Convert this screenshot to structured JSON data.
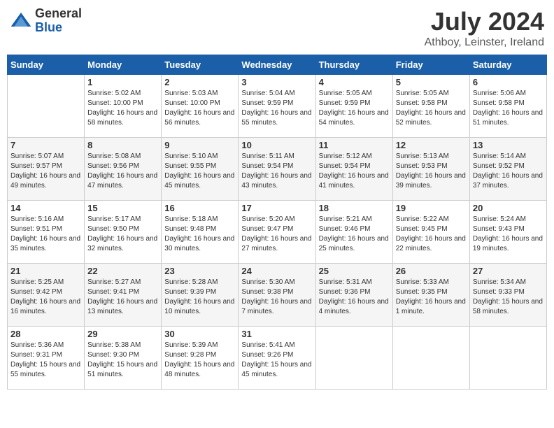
{
  "header": {
    "logo_general": "General",
    "logo_blue": "Blue",
    "month_year": "July 2024",
    "location": "Athboy, Leinster, Ireland"
  },
  "days_of_week": [
    "Sunday",
    "Monday",
    "Tuesday",
    "Wednesday",
    "Thursday",
    "Friday",
    "Saturday"
  ],
  "weeks": [
    [
      {
        "day": "",
        "sunrise": "",
        "sunset": "",
        "daylight": ""
      },
      {
        "day": "1",
        "sunrise": "Sunrise: 5:02 AM",
        "sunset": "Sunset: 10:00 PM",
        "daylight": "Daylight: 16 hours and 58 minutes."
      },
      {
        "day": "2",
        "sunrise": "Sunrise: 5:03 AM",
        "sunset": "Sunset: 10:00 PM",
        "daylight": "Daylight: 16 hours and 56 minutes."
      },
      {
        "day": "3",
        "sunrise": "Sunrise: 5:04 AM",
        "sunset": "Sunset: 9:59 PM",
        "daylight": "Daylight: 16 hours and 55 minutes."
      },
      {
        "day": "4",
        "sunrise": "Sunrise: 5:05 AM",
        "sunset": "Sunset: 9:59 PM",
        "daylight": "Daylight: 16 hours and 54 minutes."
      },
      {
        "day": "5",
        "sunrise": "Sunrise: 5:05 AM",
        "sunset": "Sunset: 9:58 PM",
        "daylight": "Daylight: 16 hours and 52 minutes."
      },
      {
        "day": "6",
        "sunrise": "Sunrise: 5:06 AM",
        "sunset": "Sunset: 9:58 PM",
        "daylight": "Daylight: 16 hours and 51 minutes."
      }
    ],
    [
      {
        "day": "7",
        "sunrise": "Sunrise: 5:07 AM",
        "sunset": "Sunset: 9:57 PM",
        "daylight": "Daylight: 16 hours and 49 minutes."
      },
      {
        "day": "8",
        "sunrise": "Sunrise: 5:08 AM",
        "sunset": "Sunset: 9:56 PM",
        "daylight": "Daylight: 16 hours and 47 minutes."
      },
      {
        "day": "9",
        "sunrise": "Sunrise: 5:10 AM",
        "sunset": "Sunset: 9:55 PM",
        "daylight": "Daylight: 16 hours and 45 minutes."
      },
      {
        "day": "10",
        "sunrise": "Sunrise: 5:11 AM",
        "sunset": "Sunset: 9:54 PM",
        "daylight": "Daylight: 16 hours and 43 minutes."
      },
      {
        "day": "11",
        "sunrise": "Sunrise: 5:12 AM",
        "sunset": "Sunset: 9:54 PM",
        "daylight": "Daylight: 16 hours and 41 minutes."
      },
      {
        "day": "12",
        "sunrise": "Sunrise: 5:13 AM",
        "sunset": "Sunset: 9:53 PM",
        "daylight": "Daylight: 16 hours and 39 minutes."
      },
      {
        "day": "13",
        "sunrise": "Sunrise: 5:14 AM",
        "sunset": "Sunset: 9:52 PM",
        "daylight": "Daylight: 16 hours and 37 minutes."
      }
    ],
    [
      {
        "day": "14",
        "sunrise": "Sunrise: 5:16 AM",
        "sunset": "Sunset: 9:51 PM",
        "daylight": "Daylight: 16 hours and 35 minutes."
      },
      {
        "day": "15",
        "sunrise": "Sunrise: 5:17 AM",
        "sunset": "Sunset: 9:50 PM",
        "daylight": "Daylight: 16 hours and 32 minutes."
      },
      {
        "day": "16",
        "sunrise": "Sunrise: 5:18 AM",
        "sunset": "Sunset: 9:48 PM",
        "daylight": "Daylight: 16 hours and 30 minutes."
      },
      {
        "day": "17",
        "sunrise": "Sunrise: 5:20 AM",
        "sunset": "Sunset: 9:47 PM",
        "daylight": "Daylight: 16 hours and 27 minutes."
      },
      {
        "day": "18",
        "sunrise": "Sunrise: 5:21 AM",
        "sunset": "Sunset: 9:46 PM",
        "daylight": "Daylight: 16 hours and 25 minutes."
      },
      {
        "day": "19",
        "sunrise": "Sunrise: 5:22 AM",
        "sunset": "Sunset: 9:45 PM",
        "daylight": "Daylight: 16 hours and 22 minutes."
      },
      {
        "day": "20",
        "sunrise": "Sunrise: 5:24 AM",
        "sunset": "Sunset: 9:43 PM",
        "daylight": "Daylight: 16 hours and 19 minutes."
      }
    ],
    [
      {
        "day": "21",
        "sunrise": "Sunrise: 5:25 AM",
        "sunset": "Sunset: 9:42 PM",
        "daylight": "Daylight: 16 hours and 16 minutes."
      },
      {
        "day": "22",
        "sunrise": "Sunrise: 5:27 AM",
        "sunset": "Sunset: 9:41 PM",
        "daylight": "Daylight: 16 hours and 13 minutes."
      },
      {
        "day": "23",
        "sunrise": "Sunrise: 5:28 AM",
        "sunset": "Sunset: 9:39 PM",
        "daylight": "Daylight: 16 hours and 10 minutes."
      },
      {
        "day": "24",
        "sunrise": "Sunrise: 5:30 AM",
        "sunset": "Sunset: 9:38 PM",
        "daylight": "Daylight: 16 hours and 7 minutes."
      },
      {
        "day": "25",
        "sunrise": "Sunrise: 5:31 AM",
        "sunset": "Sunset: 9:36 PM",
        "daylight": "Daylight: 16 hours and 4 minutes."
      },
      {
        "day": "26",
        "sunrise": "Sunrise: 5:33 AM",
        "sunset": "Sunset: 9:35 PM",
        "daylight": "Daylight: 16 hours and 1 minute."
      },
      {
        "day": "27",
        "sunrise": "Sunrise: 5:34 AM",
        "sunset": "Sunset: 9:33 PM",
        "daylight": "Daylight: 15 hours and 58 minutes."
      }
    ],
    [
      {
        "day": "28",
        "sunrise": "Sunrise: 5:36 AM",
        "sunset": "Sunset: 9:31 PM",
        "daylight": "Daylight: 15 hours and 55 minutes."
      },
      {
        "day": "29",
        "sunrise": "Sunrise: 5:38 AM",
        "sunset": "Sunset: 9:30 PM",
        "daylight": "Daylight: 15 hours and 51 minutes."
      },
      {
        "day": "30",
        "sunrise": "Sunrise: 5:39 AM",
        "sunset": "Sunset: 9:28 PM",
        "daylight": "Daylight: 15 hours and 48 minutes."
      },
      {
        "day": "31",
        "sunrise": "Sunrise: 5:41 AM",
        "sunset": "Sunset: 9:26 PM",
        "daylight": "Daylight: 15 hours and 45 minutes."
      },
      {
        "day": "",
        "sunrise": "",
        "sunset": "",
        "daylight": ""
      },
      {
        "day": "",
        "sunrise": "",
        "sunset": "",
        "daylight": ""
      },
      {
        "day": "",
        "sunrise": "",
        "sunset": "",
        "daylight": ""
      }
    ]
  ]
}
